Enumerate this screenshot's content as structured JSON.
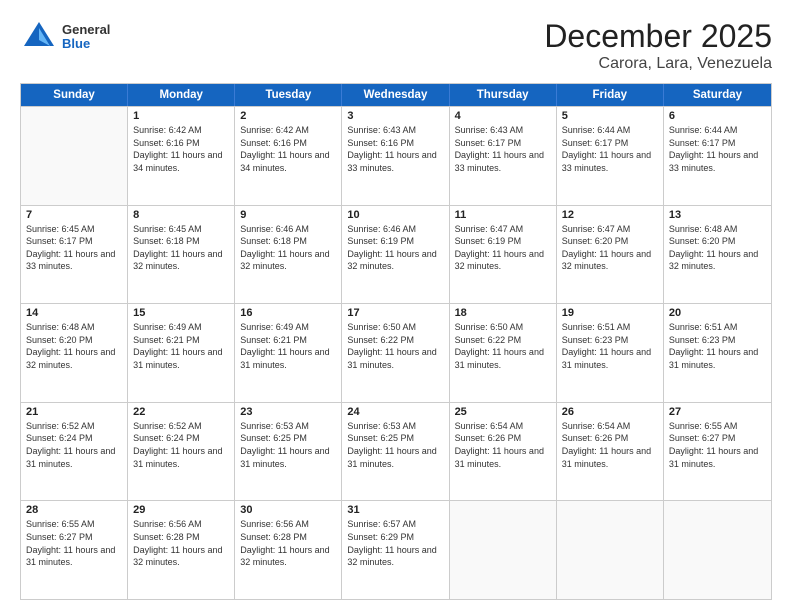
{
  "header": {
    "logo": {
      "line1": "General",
      "line2": "Blue"
    },
    "title": "December 2025",
    "subtitle": "Carora, Lara, Venezuela"
  },
  "calendar": {
    "days_of_week": [
      "Sunday",
      "Monday",
      "Tuesday",
      "Wednesday",
      "Thursday",
      "Friday",
      "Saturday"
    ],
    "weeks": [
      [
        {
          "day": "",
          "sunrise": "",
          "sunset": "",
          "daylight": "",
          "empty": true
        },
        {
          "day": "1",
          "sunrise": "Sunrise: 6:42 AM",
          "sunset": "Sunset: 6:16 PM",
          "daylight": "Daylight: 11 hours and 34 minutes."
        },
        {
          "day": "2",
          "sunrise": "Sunrise: 6:42 AM",
          "sunset": "Sunset: 6:16 PM",
          "daylight": "Daylight: 11 hours and 34 minutes."
        },
        {
          "day": "3",
          "sunrise": "Sunrise: 6:43 AM",
          "sunset": "Sunset: 6:16 PM",
          "daylight": "Daylight: 11 hours and 33 minutes."
        },
        {
          "day": "4",
          "sunrise": "Sunrise: 6:43 AM",
          "sunset": "Sunset: 6:17 PM",
          "daylight": "Daylight: 11 hours and 33 minutes."
        },
        {
          "day": "5",
          "sunrise": "Sunrise: 6:44 AM",
          "sunset": "Sunset: 6:17 PM",
          "daylight": "Daylight: 11 hours and 33 minutes."
        },
        {
          "day": "6",
          "sunrise": "Sunrise: 6:44 AM",
          "sunset": "Sunset: 6:17 PM",
          "daylight": "Daylight: 11 hours and 33 minutes."
        }
      ],
      [
        {
          "day": "7",
          "sunrise": "Sunrise: 6:45 AM",
          "sunset": "Sunset: 6:17 PM",
          "daylight": "Daylight: 11 hours and 33 minutes."
        },
        {
          "day": "8",
          "sunrise": "Sunrise: 6:45 AM",
          "sunset": "Sunset: 6:18 PM",
          "daylight": "Daylight: 11 hours and 32 minutes."
        },
        {
          "day": "9",
          "sunrise": "Sunrise: 6:46 AM",
          "sunset": "Sunset: 6:18 PM",
          "daylight": "Daylight: 11 hours and 32 minutes."
        },
        {
          "day": "10",
          "sunrise": "Sunrise: 6:46 AM",
          "sunset": "Sunset: 6:19 PM",
          "daylight": "Daylight: 11 hours and 32 minutes."
        },
        {
          "day": "11",
          "sunrise": "Sunrise: 6:47 AM",
          "sunset": "Sunset: 6:19 PM",
          "daylight": "Daylight: 11 hours and 32 minutes."
        },
        {
          "day": "12",
          "sunrise": "Sunrise: 6:47 AM",
          "sunset": "Sunset: 6:20 PM",
          "daylight": "Daylight: 11 hours and 32 minutes."
        },
        {
          "day": "13",
          "sunrise": "Sunrise: 6:48 AM",
          "sunset": "Sunset: 6:20 PM",
          "daylight": "Daylight: 11 hours and 32 minutes."
        }
      ],
      [
        {
          "day": "14",
          "sunrise": "Sunrise: 6:48 AM",
          "sunset": "Sunset: 6:20 PM",
          "daylight": "Daylight: 11 hours and 32 minutes."
        },
        {
          "day": "15",
          "sunrise": "Sunrise: 6:49 AM",
          "sunset": "Sunset: 6:21 PM",
          "daylight": "Daylight: 11 hours and 31 minutes."
        },
        {
          "day": "16",
          "sunrise": "Sunrise: 6:49 AM",
          "sunset": "Sunset: 6:21 PM",
          "daylight": "Daylight: 11 hours and 31 minutes."
        },
        {
          "day": "17",
          "sunrise": "Sunrise: 6:50 AM",
          "sunset": "Sunset: 6:22 PM",
          "daylight": "Daylight: 11 hours and 31 minutes."
        },
        {
          "day": "18",
          "sunrise": "Sunrise: 6:50 AM",
          "sunset": "Sunset: 6:22 PM",
          "daylight": "Daylight: 11 hours and 31 minutes."
        },
        {
          "day": "19",
          "sunrise": "Sunrise: 6:51 AM",
          "sunset": "Sunset: 6:23 PM",
          "daylight": "Daylight: 11 hours and 31 minutes."
        },
        {
          "day": "20",
          "sunrise": "Sunrise: 6:51 AM",
          "sunset": "Sunset: 6:23 PM",
          "daylight": "Daylight: 11 hours and 31 minutes."
        }
      ],
      [
        {
          "day": "21",
          "sunrise": "Sunrise: 6:52 AM",
          "sunset": "Sunset: 6:24 PM",
          "daylight": "Daylight: 11 hours and 31 minutes."
        },
        {
          "day": "22",
          "sunrise": "Sunrise: 6:52 AM",
          "sunset": "Sunset: 6:24 PM",
          "daylight": "Daylight: 11 hours and 31 minutes."
        },
        {
          "day": "23",
          "sunrise": "Sunrise: 6:53 AM",
          "sunset": "Sunset: 6:25 PM",
          "daylight": "Daylight: 11 hours and 31 minutes."
        },
        {
          "day": "24",
          "sunrise": "Sunrise: 6:53 AM",
          "sunset": "Sunset: 6:25 PM",
          "daylight": "Daylight: 11 hours and 31 minutes."
        },
        {
          "day": "25",
          "sunrise": "Sunrise: 6:54 AM",
          "sunset": "Sunset: 6:26 PM",
          "daylight": "Daylight: 11 hours and 31 minutes."
        },
        {
          "day": "26",
          "sunrise": "Sunrise: 6:54 AM",
          "sunset": "Sunset: 6:26 PM",
          "daylight": "Daylight: 11 hours and 31 minutes."
        },
        {
          "day": "27",
          "sunrise": "Sunrise: 6:55 AM",
          "sunset": "Sunset: 6:27 PM",
          "daylight": "Daylight: 11 hours and 31 minutes."
        }
      ],
      [
        {
          "day": "28",
          "sunrise": "Sunrise: 6:55 AM",
          "sunset": "Sunset: 6:27 PM",
          "daylight": "Daylight: 11 hours and 31 minutes."
        },
        {
          "day": "29",
          "sunrise": "Sunrise: 6:56 AM",
          "sunset": "Sunset: 6:28 PM",
          "daylight": "Daylight: 11 hours and 32 minutes."
        },
        {
          "day": "30",
          "sunrise": "Sunrise: 6:56 AM",
          "sunset": "Sunset: 6:28 PM",
          "daylight": "Daylight: 11 hours and 32 minutes."
        },
        {
          "day": "31",
          "sunrise": "Sunrise: 6:57 AM",
          "sunset": "Sunset: 6:29 PM",
          "daylight": "Daylight: 11 hours and 32 minutes."
        },
        {
          "day": "",
          "sunrise": "",
          "sunset": "",
          "daylight": "",
          "empty": true
        },
        {
          "day": "",
          "sunrise": "",
          "sunset": "",
          "daylight": "",
          "empty": true
        },
        {
          "day": "",
          "sunrise": "",
          "sunset": "",
          "daylight": "",
          "empty": true
        }
      ]
    ]
  }
}
